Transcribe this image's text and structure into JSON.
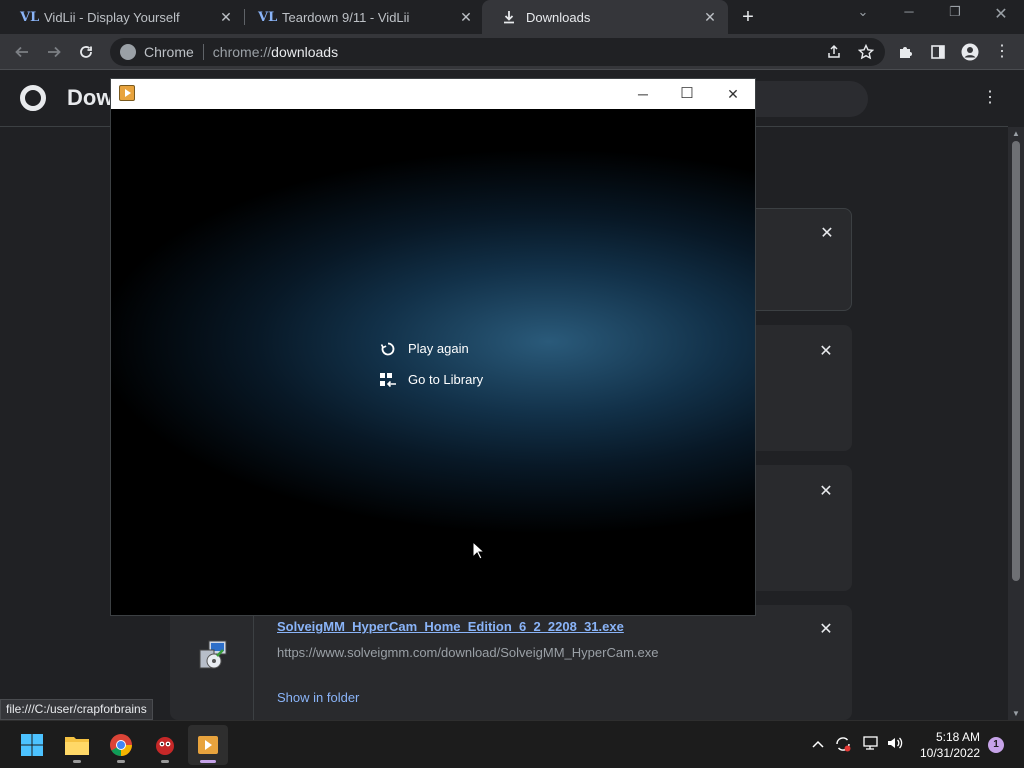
{
  "tabs": [
    {
      "favicon": "vidlii-logo-icon",
      "title": "VidLii - Display Yourself",
      "close": "✕"
    },
    {
      "favicon": "vidlii-logo-icon",
      "title": "Teardown 9/11 - VidLii",
      "close": "✕"
    },
    {
      "favicon": "download-icon",
      "title": "Downloads",
      "close": "✕",
      "active": true
    }
  ],
  "tabstrip": {
    "new_tab": "+",
    "minimize": "─",
    "restore": "❐",
    "close": "✕",
    "tab_search": "⌄"
  },
  "toolbar": {
    "omnibox_chip": "Chrome",
    "url_scheme": "chrome://",
    "url_host": "downloads"
  },
  "page": {
    "title": "Dow",
    "menu": "⋮"
  },
  "cards": [
    {
      "close": "✕"
    },
    {
      "close": "✕"
    },
    {
      "close": "✕"
    },
    {
      "close": "✕",
      "file_name": "SolveigMM_HyperCam_Home_Edition_6_2_2208_31.exe",
      "url": "https://www.solveigmm.com/download/SolveigMM_HyperCam.exe",
      "show_in_folder": "Show in folder",
      "icon": "installer-icon"
    }
  ],
  "status_bar": "file:///C:/user/crapforbrains",
  "popup": {
    "minimize": "─",
    "maximize": "☐",
    "close": "✕",
    "menu": [
      {
        "icon": "replay-icon",
        "label": "Play again"
      },
      {
        "icon": "library-icon",
        "label": "Go to Library"
      }
    ]
  },
  "taskbar": {
    "apps": [
      "windows-start-icon",
      "file-explorer-icon",
      "chrome-icon",
      "app-icon",
      "media-player-icon"
    ],
    "clock_time": "5:18 AM",
    "clock_date": "10/31/2022",
    "notification_count": "1"
  },
  "colors": {
    "accent_link": "#8ab4f8",
    "taskbar_indicator": "#c6a3e8"
  }
}
